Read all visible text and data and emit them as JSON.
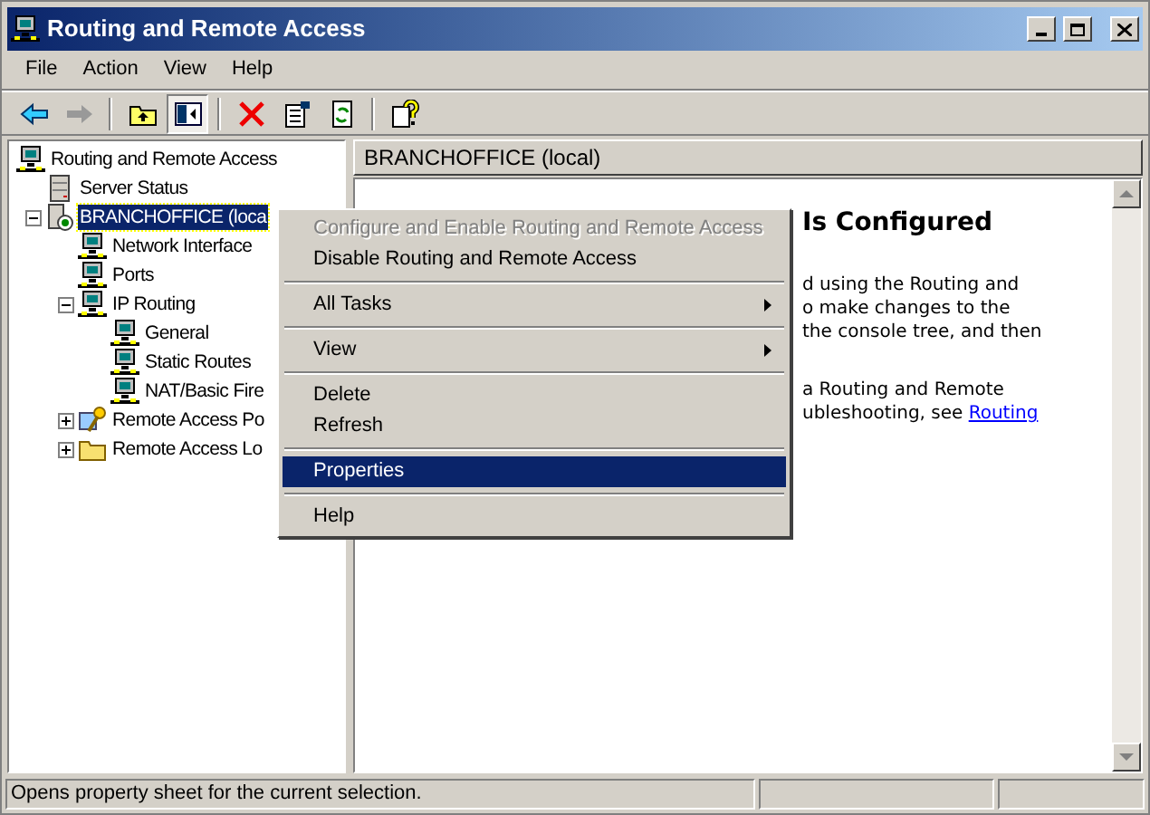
{
  "window": {
    "title": "Routing and Remote Access"
  },
  "menu_bar": [
    "File",
    "Action",
    "View",
    "Help"
  ],
  "toolbar": [
    [
      {
        "kind": "back",
        "pressed": false
      },
      {
        "kind": "forward",
        "pressed": false
      }
    ],
    [
      {
        "kind": "up",
        "pressed": false
      },
      {
        "kind": "tree",
        "pressed": true
      }
    ],
    [
      {
        "kind": "delete",
        "pressed": false
      },
      {
        "kind": "properties",
        "pressed": false
      },
      {
        "kind": "refresh",
        "pressed": false
      }
    ],
    [
      {
        "kind": "help",
        "pressed": false
      }
    ]
  ],
  "tree": [
    {
      "label": "Routing and Remote Access",
      "kind": "computer",
      "selected": false,
      "children": [
        {
          "label": "Server Status",
          "kind": "server",
          "selected": false
        },
        {
          "label": "BRANCHOFFICE (loca",
          "kind": "server-node",
          "selected": true,
          "expanded": true,
          "children": [
            {
              "label": "Network Interface",
              "kind": "computer",
              "selected": false
            },
            {
              "label": "Ports",
              "kind": "computer",
              "selected": false
            },
            {
              "label": "IP Routing",
              "kind": "computer",
              "selected": false,
              "expanded": true,
              "children": [
                {
                  "label": "General",
                  "kind": "computer",
                  "selected": false
                },
                {
                  "label": "Static Routes",
                  "kind": "computer",
                  "selected": false
                },
                {
                  "label": "NAT/Basic Fire",
                  "kind": "computer",
                  "selected": false
                }
              ]
            },
            {
              "label": "Remote Access Po",
              "kind": "policy",
              "selected": false,
              "expanded": false
            },
            {
              "label": "Remote Access Lo",
              "kind": "log",
              "selected": false,
              "expanded": false
            }
          ]
        }
      ]
    }
  ],
  "details": {
    "header": "BRANCHOFFICE (local)",
    "heading": "Is Configured",
    "paragraphs": [
      [
        "d using the Routing and",
        "o make changes to the",
        "the console tree, and then"
      ],
      [
        "a Routing and Remote",
        "ubleshooting, see "
      ]
    ],
    "link": "Routing"
  },
  "context_menu": [
    {
      "kind": "item",
      "label": "Configure and Enable Routing and Remote Access",
      "disabled": true,
      "selected": false,
      "submenu": false
    },
    {
      "kind": "item",
      "label": "Disable Routing and Remote Access",
      "disabled": false,
      "selected": false,
      "submenu": false
    },
    {
      "kind": "separator"
    },
    {
      "kind": "item",
      "label": "All Tasks",
      "disabled": false,
      "selected": false,
      "submenu": true
    },
    {
      "kind": "separator"
    },
    {
      "kind": "item",
      "label": "View",
      "disabled": false,
      "selected": false,
      "submenu": true
    },
    {
      "kind": "separator"
    },
    {
      "kind": "item",
      "label": "Delete",
      "disabled": false,
      "selected": false,
      "submenu": false
    },
    {
      "kind": "item",
      "label": "Refresh",
      "disabled": false,
      "selected": false,
      "submenu": false
    },
    {
      "kind": "separator"
    },
    {
      "kind": "item",
      "label": "Properties",
      "disabled": false,
      "selected": true,
      "submenu": false
    },
    {
      "kind": "separator"
    },
    {
      "kind": "item",
      "label": "Help",
      "disabled": false,
      "selected": false,
      "submenu": false
    }
  ],
  "status_bar": {
    "text": "Opens property sheet for the current selection."
  }
}
